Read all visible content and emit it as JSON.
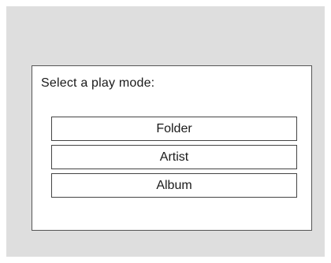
{
  "dialog": {
    "prompt": "Select a play mode:",
    "modes": [
      "Folder",
      "Artist",
      "Album"
    ]
  },
  "colors": {
    "background": "#dedede",
    "dialog": "#ffffff",
    "border": "#555555",
    "text": "#1a1a1a"
  }
}
